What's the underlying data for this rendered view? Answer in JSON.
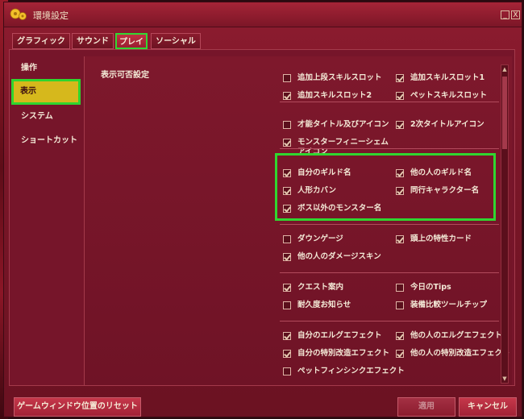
{
  "window": {
    "title": "環境設定",
    "minimize_label": "_",
    "close_label": "X"
  },
  "tabs": [
    {
      "label": "グラフィック",
      "active": false
    },
    {
      "label": "サウンド",
      "active": false
    },
    {
      "label": "プレイ",
      "active": true
    },
    {
      "label": "ソーシャル",
      "active": false
    }
  ],
  "sidebar": {
    "items": [
      {
        "label": "操作",
        "active": false
      },
      {
        "label": "表示",
        "active": true
      },
      {
        "label": "システム",
        "active": false
      },
      {
        "label": "ショートカット",
        "active": false
      }
    ]
  },
  "section_label": "表示可否設定",
  "options": [
    {
      "label": "追加上段スキルスロット",
      "checked": false
    },
    {
      "label": "追加スキルスロット1",
      "checked": true
    },
    {
      "label": "追加スキルスロット2",
      "checked": true
    },
    {
      "label": "ペットスキルスロット",
      "checked": true
    },
    {
      "label": "才能タイトル及びアイコン",
      "checked": false
    },
    {
      "label": "2次タイトルアイコン",
      "checked": true
    },
    {
      "label": "モンスターフィニーシェムアイコン",
      "checked": true
    },
    {
      "label": "自分のギルド名",
      "checked": true
    },
    {
      "label": "他の人のギルド名",
      "checked": true
    },
    {
      "label": "人形カバン",
      "checked": true
    },
    {
      "label": "同行キャラクター名",
      "checked": true
    },
    {
      "label": "ボス以外のモンスター名",
      "checked": true
    },
    {
      "label": "ダウンゲージ",
      "checked": false
    },
    {
      "label": "頭上の特性カード",
      "checked": true
    },
    {
      "label": "他の人のダメージスキン",
      "checked": true
    },
    {
      "label": "クエスト案内",
      "checked": true
    },
    {
      "label": "今日のTips",
      "checked": false
    },
    {
      "label": "耐久度お知らせ",
      "checked": false
    },
    {
      "label": "装備比較ツールチップ",
      "checked": false
    },
    {
      "label": "自分のエルグエフェクト",
      "checked": true
    },
    {
      "label": "他の人のエルグエフェクト",
      "checked": true
    },
    {
      "label": "自分の特別改造エフェクト",
      "checked": true
    },
    {
      "label": "他の人の特別改造エフェクト",
      "checked": true
    },
    {
      "label": "ペットフィンシンクエフェクト",
      "checked": false
    }
  ],
  "buttons": {
    "reset": "ゲームウィンドウ位置のリセット",
    "apply": "適用",
    "cancel": "キャンセル"
  },
  "colors": {
    "window_bg": "#7a1628",
    "highlight": "#30d630",
    "active_side": "#d6b81c"
  },
  "icons": {
    "window": "gear-icon"
  }
}
